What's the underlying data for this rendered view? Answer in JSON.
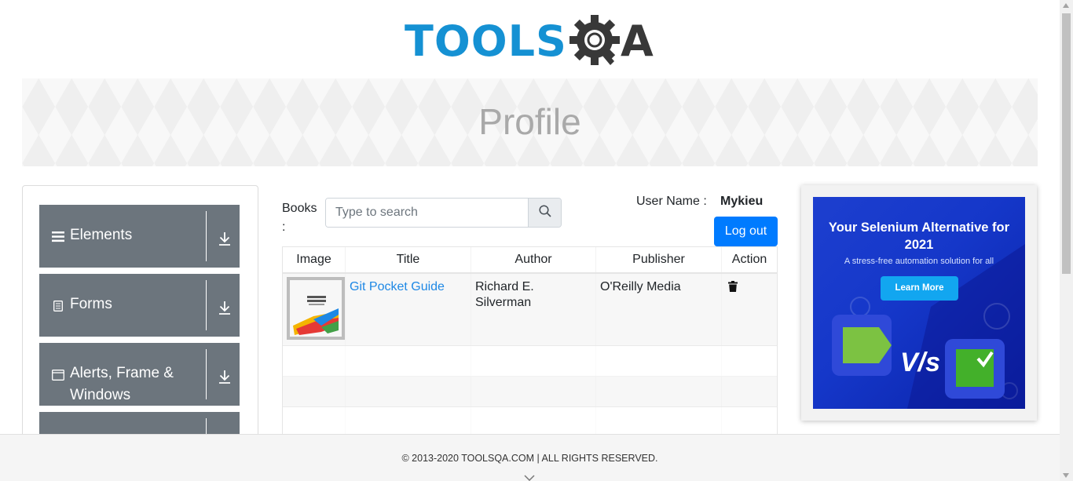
{
  "header": {
    "logo_text_primary": "TOOLS",
    "logo_text_secondary": "A",
    "logo_icon": "gear-magnifier-icon",
    "brand_color": "#1591d3"
  },
  "banner": {
    "title": "Profile"
  },
  "sidebar": {
    "groups": [
      {
        "label": "Elements",
        "icon": "menu-lines-icon"
      },
      {
        "label": "Forms",
        "icon": "document-icon"
      },
      {
        "label": "Alerts, Frame & Windows",
        "icon": "window-icon"
      },
      {
        "label": "",
        "icon": ""
      }
    ]
  },
  "books": {
    "label": "Books :",
    "search_placeholder": "Type to search",
    "search_icon": "search-icon"
  },
  "user": {
    "label": "User Name :",
    "value": "Mykieu",
    "logout_label": "Log out"
  },
  "table": {
    "columns": [
      "Image",
      "Title",
      "Author",
      "Publisher",
      "Action"
    ],
    "rows": [
      {
        "title": "Git Pocket Guide",
        "author": "Richard E. Silverman",
        "publisher": "O'Reilly Media",
        "action_icon": "trash-icon"
      }
    ],
    "empty_rows": 3
  },
  "ad": {
    "title": "Your Selenium Alternative for 2021",
    "subtitle": "A stress-free automation solution for all",
    "button": "Learn More",
    "vs": "V/s"
  },
  "footer": {
    "text": "© 2013-2020 TOOLSQA.COM | ALL RIGHTS RESERVED."
  },
  "colors": {
    "primary_button": "#007bff",
    "sidebar_group": "#6c757d",
    "link": "#1e88e5"
  }
}
